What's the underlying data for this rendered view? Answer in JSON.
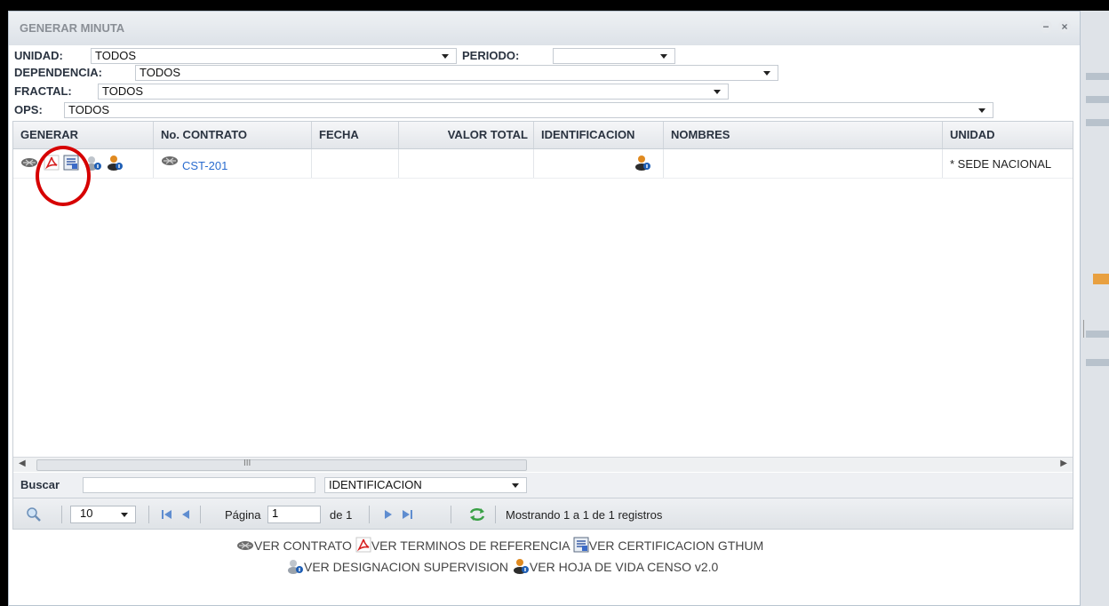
{
  "window": {
    "title": "GENERAR MINUTA",
    "minimize_label": "−",
    "close_label": "×"
  },
  "filters": {
    "unidad_label": "UNIDAD:",
    "unidad_value": "TODOS",
    "periodo_label": "PERIODO:",
    "periodo_value": "",
    "dependencia_label": "DEPENDENCIA:",
    "dependencia_value": "TODOS",
    "fractal_label": "FRACTAL:",
    "fractal_value": "TODOS",
    "ops_label": "OPS:",
    "ops_value": "TODOS"
  },
  "grid": {
    "columns": [
      "GENERAR",
      "No. CONTRATO",
      "FECHA",
      "VALOR TOTAL",
      "IDENTIFICACION",
      "NOMBRES",
      "UNIDAD"
    ],
    "rows": [
      {
        "contrato": "CST-201",
        "fecha": "",
        "valor_total": "",
        "identificacion": "",
        "nombres": "",
        "unidad": "* SEDE NACIONAL"
      }
    ],
    "scroll_thumb_label": "III"
  },
  "search": {
    "label": "Buscar",
    "value": "",
    "field_value": "IDENTIFICACION"
  },
  "pager": {
    "page_size": "10",
    "page_label": "Página",
    "page_value": "1",
    "of_label": "de 1",
    "status": "Mostrando 1 a 1 de 1 registros"
  },
  "legend": {
    "ver_contrato": "VER CONTRATO",
    "ver_terminos": "VER TERMINOS DE REFERENCIA",
    "ver_certificacion": "VER CERTIFICACION GTHUM",
    "ver_designacion": "VER DESIGNACION SUPERVISION",
    "ver_hoja_vida": "VER HOJA DE VIDA CENSO v2.0"
  },
  "colors": {
    "link": "#2a6ccf",
    "pdf_red": "#d62020",
    "highlight": "#d60000"
  }
}
